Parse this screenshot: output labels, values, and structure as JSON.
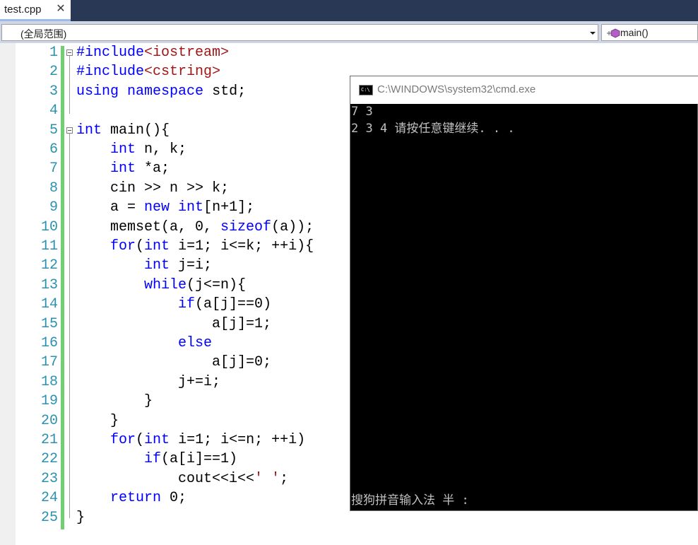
{
  "tab": {
    "title": "test.cpp",
    "close_glyph": "✕"
  },
  "navbar": {
    "scope": "(全局范围)",
    "member": "main()"
  },
  "editor": {
    "line_numbers": [
      "1",
      "2",
      "3",
      "4",
      "5",
      "6",
      "7",
      "8",
      "9",
      "10",
      "11",
      "12",
      "13",
      "14",
      "15",
      "16",
      "17",
      "18",
      "19",
      "20",
      "21",
      "22",
      "23",
      "24",
      "25"
    ],
    "lines": [
      "#include<iostream>",
      "#include<cstring>",
      "using namespace std;",
      "",
      "int main(){",
      "    int n, k;",
      "    int *a;",
      "    cin >> n >> k;",
      "    a = new int[n+1];",
      "    memset(a, 0, sizeof(a));",
      "    for(int i=1; i<=k; ++i){",
      "        int j=i;",
      "        while(j<=n){",
      "            if(a[j]==0)",
      "                a[j]=1;",
      "            else",
      "                a[j]=0;",
      "            j+=i;",
      "        }",
      "    }",
      "    for(int i=1; i<=n; ++i)",
      "        if(a[i]==1)",
      "            cout<<i<<' ';",
      "    return 0;",
      "}"
    ]
  },
  "console": {
    "title": "C:\\WINDOWS\\system32\\cmd.exe",
    "icon": "cmd-icon",
    "output": [
      "7 3",
      "2 3 4 请按任意键继续. . ."
    ],
    "ime_status": "搜狗拼音输入法 半 :"
  }
}
